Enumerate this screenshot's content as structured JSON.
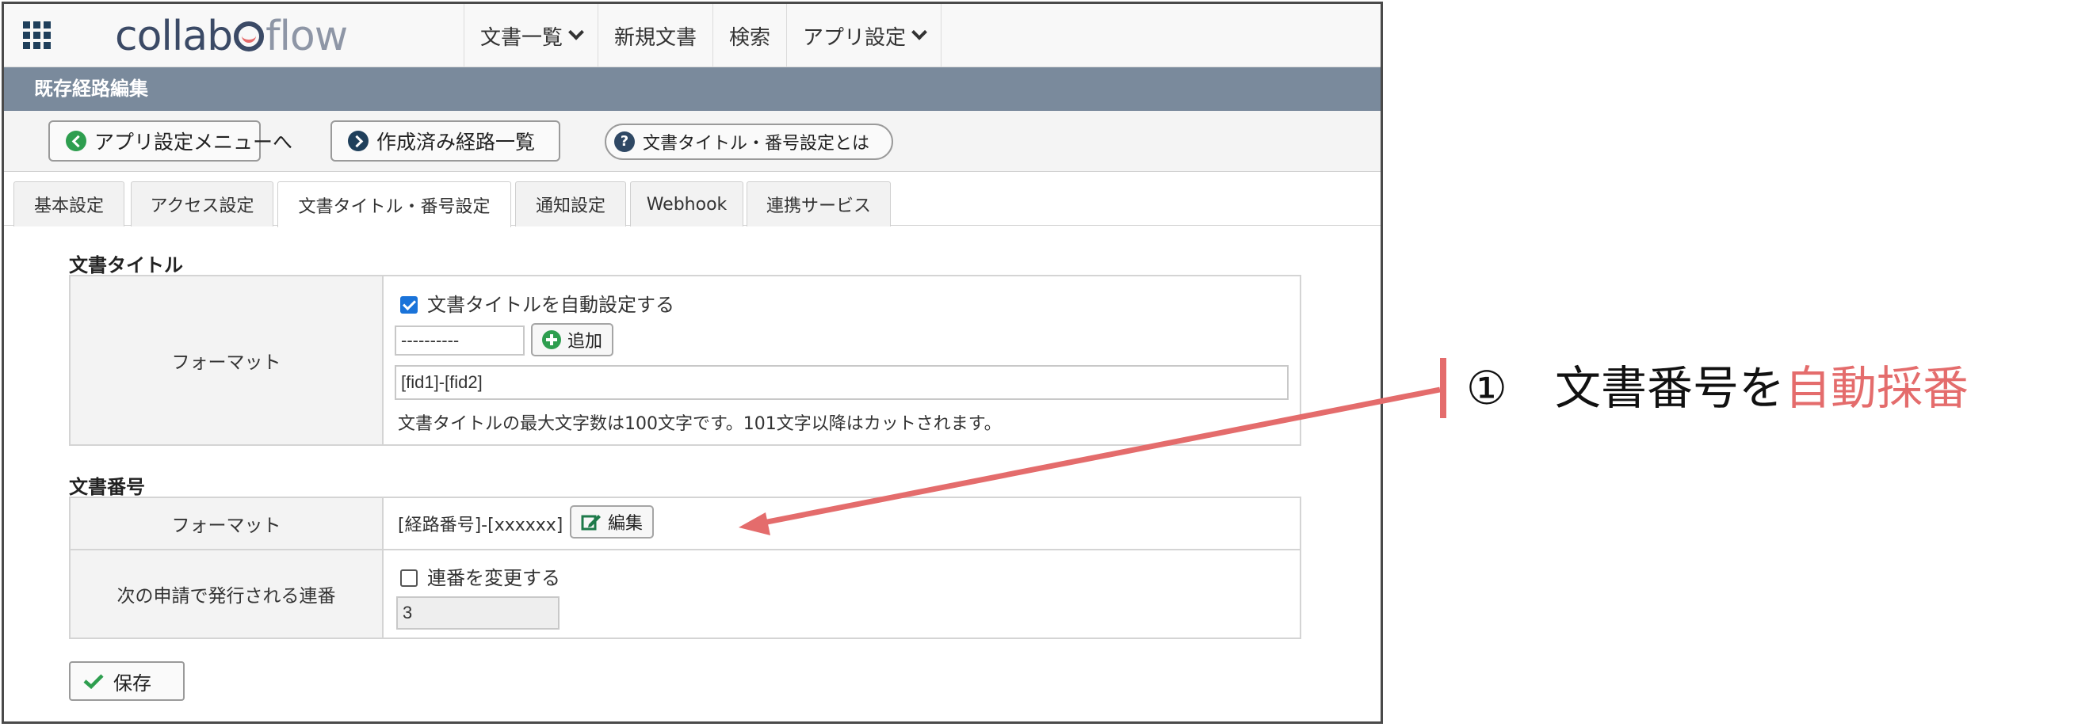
{
  "navbar": {
    "logo_main": "collab",
    "logo_flow": "flow",
    "menu": [
      {
        "label": "文書一覧",
        "dropdown": true
      },
      {
        "label": "新規文書",
        "dropdown": false
      },
      {
        "label": "検索",
        "dropdown": false
      },
      {
        "label": "アプリ設定",
        "dropdown": true
      }
    ]
  },
  "title": "既存経路編集",
  "buttons": {
    "back": "アプリ設定メニューへ",
    "list": "作成済み経路一覧",
    "help": "文書タイトル・番号設定とは"
  },
  "tabs": [
    {
      "label": "基本設定",
      "active": false
    },
    {
      "label": "アクセス設定",
      "active": false
    },
    {
      "label": "文書タイトル・番号設定",
      "active": true
    },
    {
      "label": "通知設定",
      "active": false
    },
    {
      "label": "Webhook",
      "active": false
    },
    {
      "label": "連携サービス",
      "active": false
    }
  ],
  "doc_title": {
    "section": "文書タイトル",
    "row_label": "フォーマット",
    "auto_checkbox": "文書タイトルを自動設定する",
    "auto_checked": true,
    "select_value": "----------",
    "add_button": "追加",
    "format_value": "[fid1]-[fid2]",
    "note": "文書タイトルの最大文字数は100文字です。101文字以降はカットされます。"
  },
  "doc_number": {
    "section": "文書番号",
    "format_label": "フォーマット",
    "format_value": "[経路番号]-[xxxxxx]",
    "edit_button": "編集",
    "seq_label": "次の申請で発行される連番",
    "change_checkbox": "連番を変更する",
    "change_checked": false,
    "seq_value": "3"
  },
  "save_button": "保存",
  "annotation": {
    "number": "①",
    "text_plain": "文書番号を",
    "text_highlight": "自動採番"
  },
  "colors": {
    "titlebar": "#7a8a9c",
    "accent_red": "#e46c6c",
    "green": "#2e9e4f",
    "checkbox_blue": "#1a73d9"
  }
}
